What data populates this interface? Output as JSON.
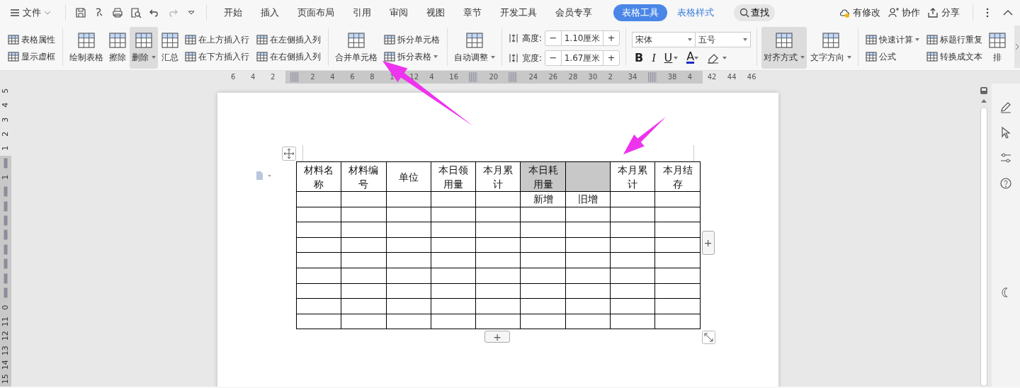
{
  "menu": {
    "label": "文件"
  },
  "tabs": [
    {
      "label": "开始",
      "kind": "normal",
      "selected": false
    },
    {
      "label": "插入",
      "kind": "normal",
      "selected": false
    },
    {
      "label": "页面布局",
      "kind": "normal",
      "selected": false
    },
    {
      "label": "引用",
      "kind": "normal",
      "selected": false
    },
    {
      "label": "审阅",
      "kind": "normal",
      "selected": false
    },
    {
      "label": "视图",
      "kind": "normal",
      "selected": false
    },
    {
      "label": "章节",
      "kind": "normal",
      "selected": false
    },
    {
      "label": "开发工具",
      "kind": "normal",
      "selected": false
    },
    {
      "label": "会员专享",
      "kind": "normal",
      "selected": false
    },
    {
      "label": "表格工具",
      "kind": "contextual",
      "selected": true
    },
    {
      "label": "表格样式",
      "kind": "contextual",
      "selected": false
    }
  ],
  "search": {
    "label": "查找"
  },
  "actions": [
    {
      "label": "有修改"
    },
    {
      "label": "协作"
    },
    {
      "label": "分享"
    }
  ],
  "ribbon": [
    {
      "kind": "stack",
      "items": [
        {
          "label": "表格属性",
          "dropdown": false
        },
        {
          "label": "显示虚框",
          "dropdown": false
        }
      ]
    },
    {
      "kind": "divider"
    },
    {
      "kind": "large",
      "label": "绘制表格",
      "dropdown": false,
      "pressed": false
    },
    {
      "kind": "large",
      "label": "擦除",
      "dropdown": false,
      "pressed": false
    },
    {
      "kind": "large",
      "label": "删除",
      "dropdown": true,
      "pressed": true
    },
    {
      "kind": "large",
      "label": "汇总",
      "dropdown": false,
      "pressed": false
    },
    {
      "kind": "stack",
      "items": [
        {
          "label": "在上方插入行",
          "dropdown": false
        },
        {
          "label": "在下方插入行",
          "dropdown": false
        }
      ]
    },
    {
      "kind": "stack",
      "items": [
        {
          "label": "在左侧插入列",
          "dropdown": false
        },
        {
          "label": "在右侧插入列",
          "dropdown": false
        }
      ]
    },
    {
      "kind": "divider"
    },
    {
      "kind": "large",
      "label": "合并单元格",
      "dropdown": false,
      "pressed": false
    },
    {
      "kind": "stack",
      "items": [
        {
          "label": "拆分单元格",
          "dropdown": false
        },
        {
          "label": "拆分表格",
          "dropdown": true
        }
      ]
    },
    {
      "kind": "divider"
    },
    {
      "kind": "large",
      "label": "自动调整",
      "dropdown": true,
      "pressed": false
    },
    {
      "kind": "divider"
    },
    {
      "kind": "size",
      "fields": [
        {
          "label": "高度:",
          "minus": "−",
          "value": "1.10厘米",
          "plus": "+"
        },
        {
          "label": "宽度:",
          "minus": "−",
          "value": "1.67厘米",
          "plus": "+"
        }
      ]
    },
    {
      "kind": "divider"
    },
    {
      "kind": "font",
      "font": "宋体",
      "size": "五号",
      "formats": [
        {
          "label": "B",
          "kind": "bold"
        },
        {
          "label": "I",
          "kind": "italic"
        },
        {
          "label": "U",
          "kind": "underline"
        },
        {
          "label": "A",
          "kind": "color"
        }
      ]
    },
    {
      "kind": "divider"
    },
    {
      "kind": "large",
      "label": "对齐方式",
      "dropdown": true,
      "pressed": true
    },
    {
      "kind": "large",
      "label": "文字方向",
      "dropdown": true,
      "pressed": false
    },
    {
      "kind": "divider"
    },
    {
      "kind": "stack",
      "items": [
        {
          "label": "快速计算",
          "dropdown": true
        },
        {
          "label": "公式",
          "dropdown": false
        }
      ]
    },
    {
      "kind": "stack",
      "items": [
        {
          "label": "标题行重复",
          "dropdown": false
        },
        {
          "label": "转换成文本",
          "dropdown": false
        }
      ]
    },
    {
      "kind": "large",
      "label": "排",
      "dropdown": false,
      "pressed": false
    }
  ],
  "ruler": {
    "horizontal": [
      {
        "kind": "number",
        "label": "6",
        "in_table": false
      },
      {
        "kind": "number",
        "label": "4",
        "in_table": false
      },
      {
        "kind": "number",
        "label": "2",
        "in_table": false
      },
      {
        "kind": "marker",
        "in_table": true
      },
      {
        "kind": "number",
        "label": "2",
        "in_table": true
      },
      {
        "kind": "number",
        "label": "4",
        "in_table": true
      },
      {
        "kind": "number",
        "label": "6",
        "in_table": true
      },
      {
        "kind": "number",
        "label": "8",
        "in_table": true
      },
      {
        "kind": "number",
        "label": "1",
        "in_table": true
      },
      {
        "kind": "number",
        "label": "12",
        "in_table": true
      },
      {
        "kind": "number",
        "label": "4",
        "in_table": true
      },
      {
        "kind": "number",
        "label": "16",
        "in_table": true
      },
      {
        "kind": "marker",
        "in_table": true
      },
      {
        "kind": "number",
        "label": "20",
        "in_table": true
      },
      {
        "kind": "marker",
        "in_table": true
      },
      {
        "kind": "number",
        "label": "24",
        "in_table": true
      },
      {
        "kind": "number",
        "label": "26",
        "in_table": true
      },
      {
        "kind": "number",
        "label": "28",
        "in_table": true
      },
      {
        "kind": "number",
        "label": "30",
        "in_table": true
      },
      {
        "kind": "number",
        "label": "2",
        "in_table": true
      },
      {
        "kind": "number",
        "label": "34",
        "in_table": true
      },
      {
        "kind": "marker",
        "in_table": true
      },
      {
        "kind": "number",
        "label": "38",
        "in_table": true
      },
      {
        "kind": "number",
        "label": "4",
        "in_table": true
      },
      {
        "kind": "number",
        "label": "42",
        "in_table": false
      },
      {
        "kind": "number",
        "label": "44",
        "in_table": false
      },
      {
        "kind": "number",
        "label": "46",
        "in_table": false
      }
    ],
    "vertical": [
      {
        "kind": "number",
        "label": "5",
        "in_table": false
      },
      {
        "kind": "number",
        "label": "4",
        "in_table": false
      },
      {
        "kind": "number",
        "label": "3",
        "in_table": false
      },
      {
        "kind": "number",
        "label": "2",
        "in_table": false
      },
      {
        "kind": "number",
        "label": "1",
        "in_table": false
      },
      {
        "kind": "marker",
        "in_table": true
      },
      {
        "kind": "number",
        "label": "1",
        "in_table": true
      },
      {
        "kind": "marker",
        "in_table": true
      },
      {
        "kind": "marker",
        "in_table": true
      },
      {
        "kind": "marker",
        "in_table": true
      },
      {
        "kind": "marker",
        "in_table": true
      },
      {
        "kind": "marker",
        "in_table": true
      },
      {
        "kind": "marker",
        "in_table": true
      },
      {
        "kind": "marker",
        "in_table": true
      },
      {
        "kind": "marker",
        "in_table": true
      },
      {
        "kind": "number",
        "label": "0",
        "in_table": true
      },
      {
        "kind": "number",
        "label": "11",
        "in_table": true
      },
      {
        "kind": "number",
        "label": "12",
        "in_table": true
      },
      {
        "kind": "number",
        "label": "13",
        "in_table": true
      },
      {
        "kind": "number",
        "label": "14",
        "in_table": true
      },
      {
        "kind": "number",
        "label": "15",
        "in_table": true
      }
    ]
  },
  "table": {
    "header": [
      {
        "text": "材料名称",
        "selected": false
      },
      {
        "text": "材料编号",
        "selected": false
      },
      {
        "text": "单位",
        "selected": false
      },
      {
        "text": "本日领用量",
        "selected": false
      },
      {
        "text": "本月累计",
        "selected": false
      },
      {
        "text": "本日耗用量",
        "selected": true
      },
      {
        "selected": true
      },
      {
        "text": "本月累计",
        "selected": false
      },
      {
        "text": "本月结存",
        "selected": false
      }
    ],
    "rows": [
      {
        "kind": "subheader",
        "cells": [
          {
            "kind": "blank"
          },
          {
            "kind": "blank"
          },
          {
            "kind": "blank"
          },
          {
            "kind": "blank"
          },
          {
            "kind": "blank"
          },
          {
            "kind": "text",
            "text": "新增"
          },
          {
            "kind": "text",
            "text": "旧增"
          },
          {
            "kind": "blank"
          },
          {
            "kind": "blank"
          }
        ]
      },
      {
        "kind": "empty"
      },
      {
        "kind": "empty"
      },
      {
        "kind": "empty"
      },
      {
        "kind": "empty"
      },
      {
        "kind": "empty"
      },
      {
        "kind": "empty"
      },
      {
        "kind": "empty"
      },
      {
        "kind": "empty"
      }
    ]
  },
  "table_controls": {
    "add_column": "+",
    "add_row": "+"
  }
}
